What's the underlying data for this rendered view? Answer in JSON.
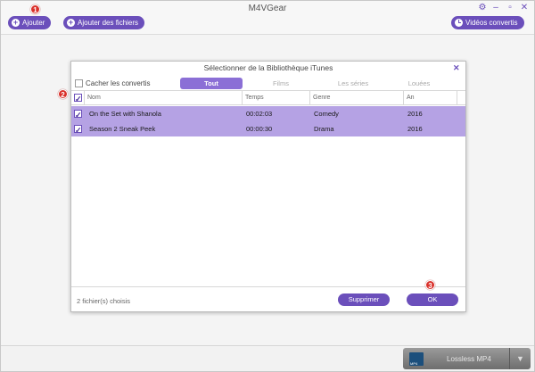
{
  "app": {
    "title": "M4VGear"
  },
  "toolbar": {
    "add_label": "Ajouter",
    "add_files_label": "Ajouter des fichiers",
    "converted_label": "Vidéos convertis"
  },
  "window_controls": {
    "settings": "⚙",
    "minimize": "–",
    "maximize": "▫",
    "close": "✕"
  },
  "steps": [
    "1",
    "2",
    "3"
  ],
  "dialog": {
    "title": "Sélectionner de la Bibliothèque iTunes",
    "close": "✕",
    "hide_converted_label": "Cacher les convertis",
    "tabs": [
      {
        "label": "Tout",
        "active": true
      },
      {
        "label": "Films",
        "active": false
      },
      {
        "label": "Les séries",
        "active": false
      },
      {
        "label": "Louées",
        "active": false
      }
    ],
    "columns": [
      "Nom",
      "Temps",
      "Genre",
      "An"
    ],
    "rows": [
      {
        "name": "On the Set with Shanola",
        "time": "00:02:03",
        "genre": "Comedy",
        "year": "2016",
        "checked": true
      },
      {
        "name": "Season 2 Sneak Peek",
        "time": "00:00:30",
        "genre": "Drama",
        "year": "2016",
        "checked": true
      }
    ],
    "selected_count": "2 fichier(s) choisis",
    "delete_label": "Supprimer",
    "ok_label": "OK"
  },
  "output_format": {
    "label": "Lossless MP4",
    "arrow": "▼"
  },
  "colors": {
    "accent": "#6b4fbb",
    "row_selected": "#b5a2e4",
    "badge": "#d9302a"
  }
}
